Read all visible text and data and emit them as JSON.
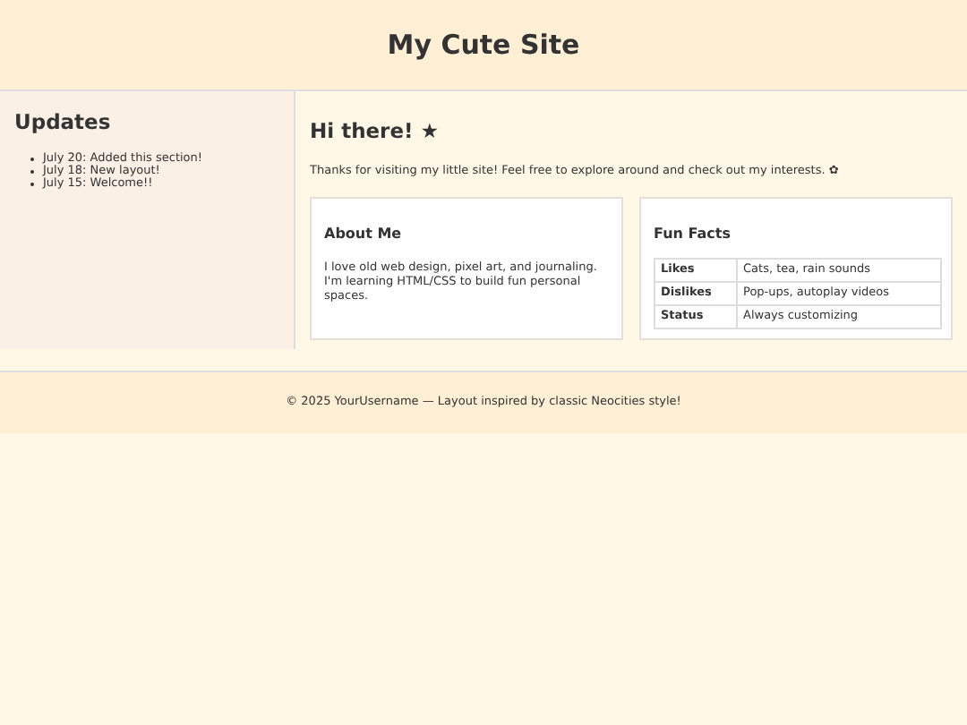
{
  "header": {
    "title": "My Cute Site"
  },
  "sidebar": {
    "title": "Updates",
    "items": [
      "July 20: Added this section!",
      "July 18: New layout!",
      "July 15: Welcome!!"
    ]
  },
  "main": {
    "title": "Hi there! ★",
    "intro": "Thanks for visiting my little site! Feel free to explore around and check out my interests. ✿",
    "about": {
      "title": "About Me",
      "text": "I love old web design, pixel art, and journaling. I'm learning HTML/CSS to build fun personal spaces."
    },
    "facts": {
      "title": "Fun Facts",
      "rows": [
        {
          "label": "Likes",
          "value": "Cats, tea, rain sounds"
        },
        {
          "label": "Dislikes",
          "value": "Pop-ups, autoplay videos"
        },
        {
          "label": "Status",
          "value": "Always customizing"
        }
      ]
    }
  },
  "footer": {
    "text": "© 2025 YourUsername — Layout inspired by classic Neocities style!"
  }
}
